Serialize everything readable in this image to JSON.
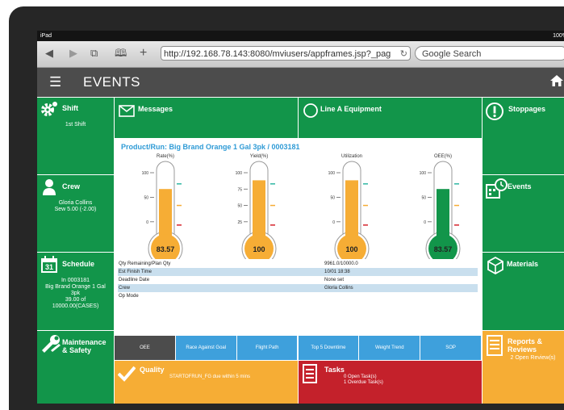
{
  "device": {
    "carrier": "iPad",
    "battery": "100%"
  },
  "browser": {
    "url": "http://192.168.78.143:8080/mviusers/appframes.jsp?_pag",
    "search_placeholder": "Google Search",
    "icons": [
      "back-icon",
      "forward-icon",
      "tabs-icon",
      "bookmarks-icon",
      "add-icon",
      "reload-icon"
    ]
  },
  "app": {
    "title": "EVENTS"
  },
  "left_tiles": [
    {
      "title": "Shift",
      "sub": [
        "1st Shift"
      ]
    },
    {
      "title": "Crew",
      "sub": [
        "Gloria Collins",
        "Sew 5.00 (-2.00)"
      ]
    },
    {
      "title": "Schedule",
      "sub": [
        "In 0003181",
        "Big Brand Orange 1 Gal",
        "3pk",
        "39.00 of",
        "10000.00(CASES)"
      ],
      "badge": "31"
    },
    {
      "title": "Maintenance",
      "title2": "& Safety"
    }
  ],
  "right_tiles": [
    {
      "title": "Stoppages"
    },
    {
      "title": "Events"
    },
    {
      "title": "Materials"
    },
    {
      "title": "Reports &",
      "title2": "Reviews",
      "sub": "2 Open Review(s)"
    }
  ],
  "top_tiles": [
    {
      "title": "Messages"
    },
    {
      "title": "Line A Equipment"
    }
  ],
  "product_run": "Product/Run: Big Brand Orange 1 Gal 3pk / 0003181",
  "gauges": [
    {
      "title": "Rate(%)",
      "value": "83.57",
      "fill": 0.62,
      "color": "#f6ad35",
      "ticks": [
        "100",
        "50",
        "0"
      ]
    },
    {
      "title": "Yield(%)",
      "value": "100",
      "fill": 0.74,
      "color": "#f6ad35",
      "ticks": [
        "100",
        "75",
        "50",
        "25"
      ]
    },
    {
      "title": "Utilization",
      "value": "100",
      "fill": 0.74,
      "color": "#f6ad35",
      "ticks": [
        "100",
        "50",
        "0"
      ]
    },
    {
      "title": "OEE(%)",
      "value": "83.57",
      "fill": 0.62,
      "color": "#12954a",
      "ticks": [
        "100",
        "50",
        "0"
      ]
    }
  ],
  "props": [
    {
      "label": "Qty Remaining/Plan Qty",
      "value": "9961.0/10000.0",
      "shaded": false
    },
    {
      "label": "Est Finish Time",
      "value": "10/01 18:38",
      "shaded": true
    },
    {
      "label": "Deadline Date",
      "value": "None set",
      "shaded": false
    },
    {
      "label": "Crew",
      "value": "Gloria Collins",
      "shaded": true
    },
    {
      "label": "Op Mode",
      "value": "",
      "shaded": false
    }
  ],
  "buttons": [
    "OEE",
    "Race Against Goal",
    "Flight Path",
    "Top 5 Downtime",
    "Weight Trend",
    "SOP"
  ],
  "quality": {
    "title": "Quality",
    "text": "STARTOFRUN_FG due within 5 mins"
  },
  "tasks": {
    "title": "Tasks",
    "line1": "0 Open Task(s)",
    "line2": "1 Overdue Task(s)"
  },
  "colors": {
    "green": "#12954a",
    "orange": "#f6ad35",
    "blue": "#3ea0dc",
    "red": "#c4212b",
    "dark": "#4c4c4c"
  }
}
